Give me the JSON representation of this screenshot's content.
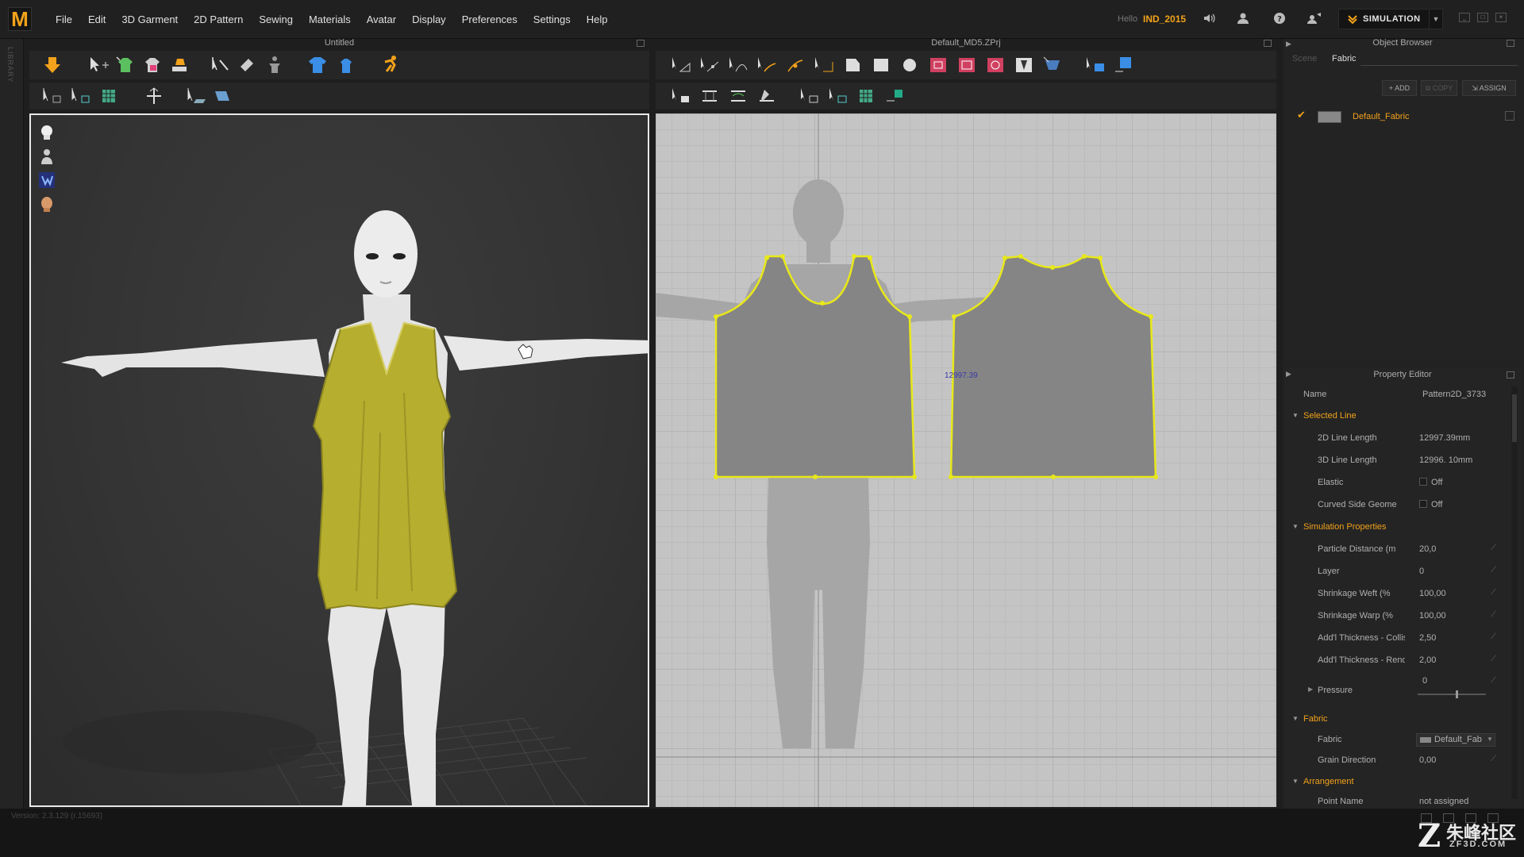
{
  "app": {
    "logo": "M",
    "menu": [
      "File",
      "Edit",
      "3D Garment",
      "2D Pattern",
      "Sewing",
      "Materials",
      "Avatar",
      "Display",
      "Preferences",
      "Settings",
      "Help"
    ],
    "hello": "Hello",
    "username": "IND_2015",
    "mode_button": "SIMULATION",
    "icons": [
      "speaker-icon",
      "user-icon",
      "help-icon",
      "share-icon"
    ]
  },
  "library": {
    "label": "LIBRARY"
  },
  "view3d": {
    "title": "Untitled"
  },
  "view2d": {
    "title": "Default_MD5.ZPrj",
    "line_length_label": "12997.39"
  },
  "object_browser": {
    "title": "Object Browser",
    "tabs": [
      "Scene",
      "Fabric"
    ],
    "active_tab": "Fabric",
    "buttons": {
      "add": "ADD",
      "copy": "COPY",
      "assign": "ASSIGN"
    },
    "fabrics": [
      {
        "name": "Default_Fabric",
        "checked": true
      }
    ]
  },
  "property_editor": {
    "title": "Property Editor",
    "name_label": "Name",
    "name_value": "Pattern2D_3733",
    "sections": {
      "selected_line": "Selected Line",
      "simulation": "Simulation Properties",
      "fabric": "Fabric",
      "arrangement": "Arrangement"
    },
    "selected_line": [
      {
        "label": "2D Line Length",
        "value": "12997.39mm"
      },
      {
        "label": "3D Line Length",
        "value": "12996. 10mm"
      },
      {
        "label": "Elastic",
        "value": "Off"
      },
      {
        "label": "Curved Side Geome",
        "value": "Off"
      }
    ],
    "simulation": [
      {
        "label": "Particle Distance (m",
        "value": "20,0"
      },
      {
        "label": "Layer",
        "value": "0"
      },
      {
        "label": "Shrinkage Weft (%",
        "value": "100,00"
      },
      {
        "label": "Shrinkage Warp (%",
        "value": "100,00"
      },
      {
        "label": "Add'l Thickness - Collisio",
        "value": "2,50"
      },
      {
        "label": "Add'l Thickness - Renderi",
        "value": "2,00"
      }
    ],
    "pressure": {
      "label": "Pressure",
      "value": "0"
    },
    "fabric": [
      {
        "label": "Fabric",
        "value": "Default_Fab"
      },
      {
        "label": "Grain Direction",
        "value": "0,00"
      }
    ],
    "arrangement": [
      {
        "label": "Point Name",
        "value": "not assigned"
      }
    ]
  },
  "status": {
    "version": "Version: 2.3.129    (r.15693)"
  },
  "watermark": {
    "glyph": "Z",
    "cn": "朱峰社区",
    "en": "ZF3D.COM"
  },
  "colors": {
    "accent": "#f2a21b",
    "garment": "#b8b030",
    "pattern_outline": "#e8e81a",
    "pattern_fill": "#858585"
  }
}
